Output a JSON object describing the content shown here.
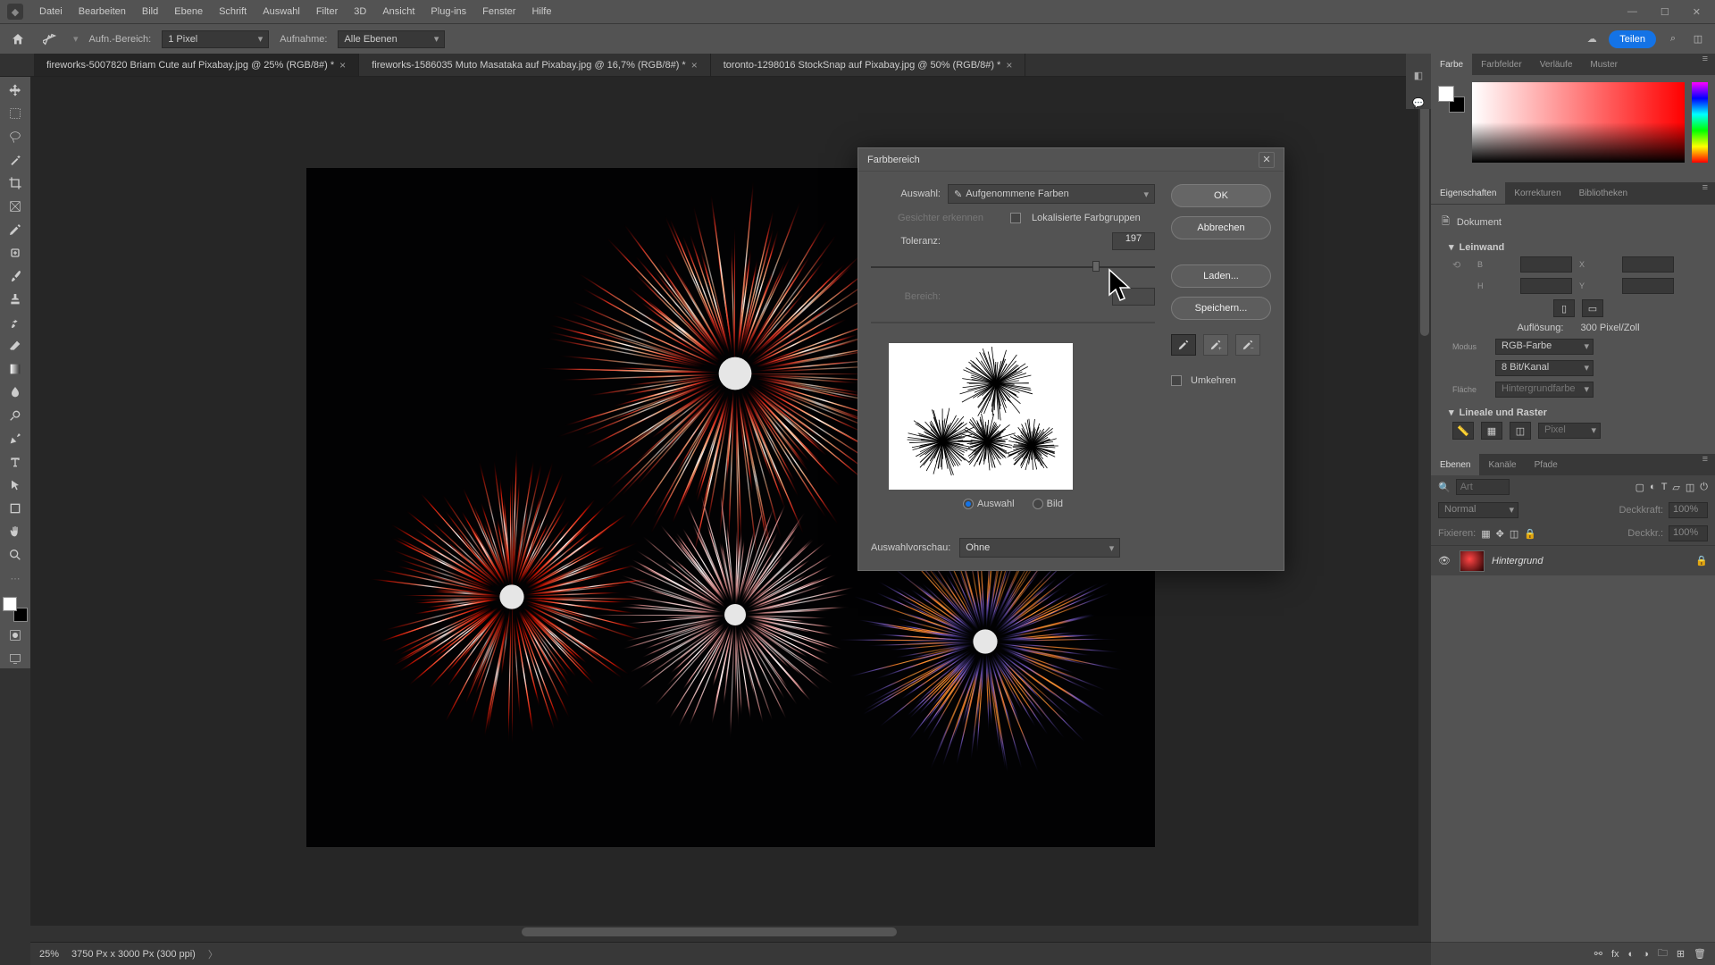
{
  "menu": {
    "items": [
      "Datei",
      "Bearbeiten",
      "Bild",
      "Ebene",
      "Schrift",
      "Auswahl",
      "Filter",
      "3D",
      "Ansicht",
      "Plug-ins",
      "Fenster",
      "Hilfe"
    ]
  },
  "options_bar": {
    "sample_label": "Aufn.-Bereich:",
    "sample_value": "1 Pixel",
    "layers_label": "Aufnahme:",
    "layers_value": "Alle Ebenen",
    "share": "Teilen"
  },
  "tabs": [
    {
      "label": "fireworks-5007820 Briam Cute auf Pixabay.jpg @ 25% (RGB/8#) *",
      "active": true
    },
    {
      "label": "fireworks-1586035 Muto Masataka auf Pixabay.jpg @ 16,7% (RGB/8#) *",
      "active": false
    },
    {
      "label": "toronto-1298016 StockSnap auf Pixabay.jpg @ 50% (RGB/8#) *",
      "active": false
    }
  ],
  "status": {
    "zoom": "25%",
    "doc_info": "3750 Px x 3000 Px (300 ppi)"
  },
  "panels": {
    "color_tabs": [
      "Farbe",
      "Farbfelder",
      "Verläufe",
      "Muster"
    ],
    "prop_tabs": [
      "Eigenschaften",
      "Korrekturen",
      "Bibliotheken"
    ],
    "doc_label": "Dokument",
    "canvas_head": "Leinwand",
    "w_label": "B",
    "h_label": "H",
    "x_label": "X",
    "y_label": "Y",
    "res_label": "Auflösung:",
    "res_value": "300 Pixel/Zoll",
    "mode_label": "Modus",
    "mode_value": "RGB-Farbe",
    "depth_value": "8 Bit/Kanal",
    "fill_label": "Fläche",
    "fill_value": "Hintergrundfarbe",
    "rulers_head": "Lineale und Raster",
    "pixel": "Pixel",
    "layer_tabs": [
      "Ebenen",
      "Kanäle",
      "Pfade"
    ],
    "blend": "Normal",
    "opacity_label": "Deckkraft:",
    "opacity_value": "100%",
    "lock_label": "Fixieren:",
    "fill_label2": "Deckkr.:",
    "fill_value2": "100%",
    "layer_name": "Hintergrund",
    "search_placeholder": "Art"
  },
  "dialog": {
    "title": "Farbbereich",
    "select_label": "Auswahl:",
    "select_value": "Aufgenommene Farben",
    "faces": "Gesichter erkennen",
    "localized": "Lokalisierte Farbgruppen",
    "tolerance": "Toleranz:",
    "tolerance_value": "197",
    "range": "Bereich:",
    "radio_selection": "Auswahl",
    "radio_image": "Bild",
    "preview_label": "Auswahlvorschau:",
    "preview_value": "Ohne",
    "ok": "OK",
    "cancel": "Abbrechen",
    "load": "Laden...",
    "save": "Speichern...",
    "invert": "Umkehren"
  }
}
